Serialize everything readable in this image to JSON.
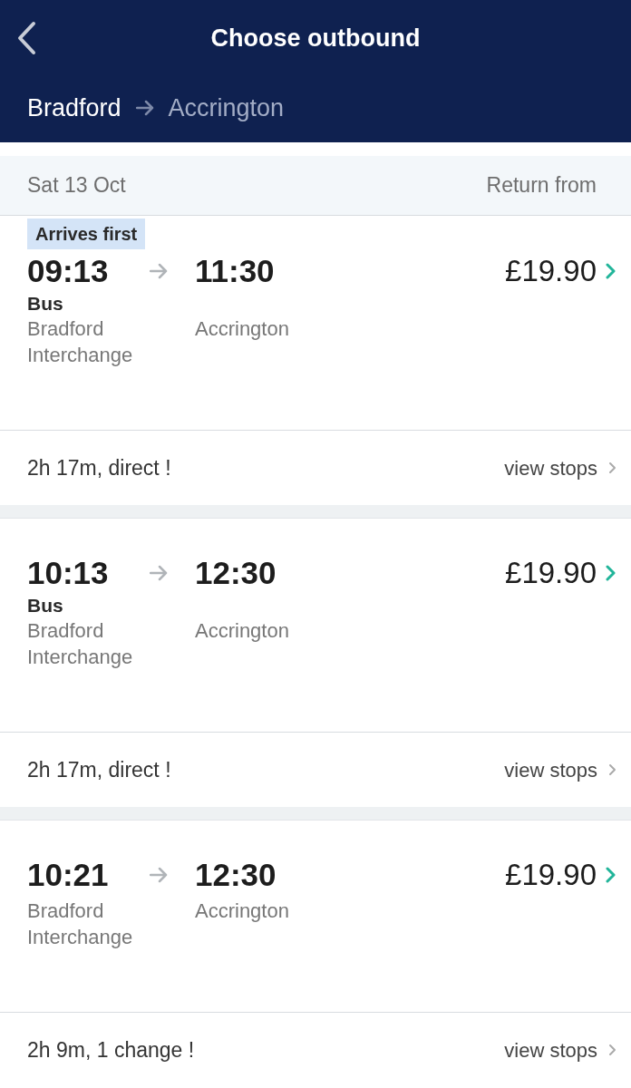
{
  "header": {
    "title": "Choose outbound",
    "origin": "Bradford",
    "destination": "Accrington"
  },
  "date_bar": {
    "date": "Sat 13 Oct",
    "return_label": "Return from"
  },
  "journeys": [
    {
      "badge": "Arrives first",
      "depart_time": "09:13",
      "arrive_time": "11:30",
      "mode": "Bus",
      "depart_station": "Bradford Interchange",
      "arrive_station": "Accrington",
      "price": "£19.90",
      "summary": "2h 17m, direct !",
      "link": "view stops"
    },
    {
      "depart_time": "10:13",
      "arrive_time": "12:30",
      "mode": "Bus",
      "depart_station": "Bradford Interchange",
      "arrive_station": "Accrington",
      "price": "£19.90",
      "summary": "2h 17m, direct !",
      "link": "view stops"
    },
    {
      "depart_time": "10:21",
      "arrive_time": "12:30",
      "depart_station": "Bradford Interchange",
      "arrive_station": "Accrington",
      "price": "£19.90",
      "summary": "2h 9m, 1 change !",
      "link": "view stops"
    }
  ]
}
